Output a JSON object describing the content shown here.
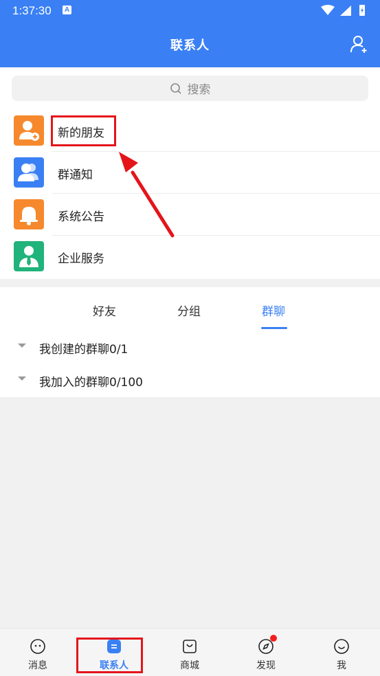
{
  "status_bar": {
    "time": "1:37:30",
    "badge": "A"
  },
  "header": {
    "title": "联系人"
  },
  "search": {
    "placeholder": "搜索"
  },
  "contact_entries": [
    {
      "label": "新的朋友",
      "color": "#f6892d",
      "icon": "add-friend-icon"
    },
    {
      "label": "群通知",
      "color": "#3a80f4",
      "icon": "group-notice-icon"
    },
    {
      "label": "系统公告",
      "color": "#f6892d",
      "icon": "bell-icon"
    },
    {
      "label": "企业服务",
      "color": "#20b37b",
      "icon": "business-person-icon"
    }
  ],
  "tabs": [
    {
      "label": "好友",
      "active": false
    },
    {
      "label": "分组",
      "active": false
    },
    {
      "label": "群聊",
      "active": true
    }
  ],
  "groups": [
    {
      "label": "我创建的群聊0/1"
    },
    {
      "label": "我加入的群聊0/100"
    }
  ],
  "bottom_nav": [
    {
      "label": "消息",
      "icon": "message-icon",
      "active": false
    },
    {
      "label": "联系人",
      "icon": "contacts-icon",
      "active": true
    },
    {
      "label": "商城",
      "icon": "shopping-bag-icon",
      "active": false
    },
    {
      "label": "发现",
      "icon": "compass-icon",
      "active": false,
      "badge_dot": true
    },
    {
      "label": "我",
      "icon": "smile-icon",
      "active": false
    }
  ],
  "colors": {
    "primary": "#3a80f4",
    "highlight": "#e5141b",
    "orange": "#f6892d",
    "green": "#20b37b"
  }
}
